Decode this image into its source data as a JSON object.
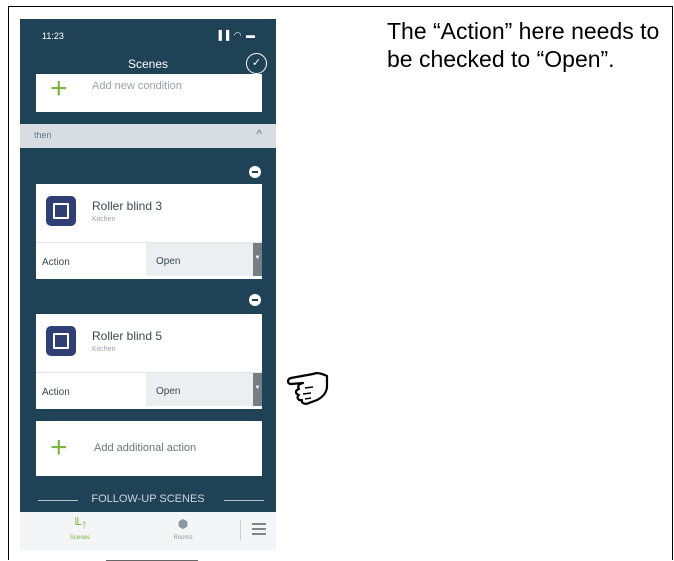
{
  "status": {
    "time": "11:23",
    "icons": "▐▐ ◠ ▬"
  },
  "nav": {
    "title": "Scenes",
    "confirm_glyph": "✓"
  },
  "condition": {
    "add_label": "Add new condition",
    "plus_glyph": "+"
  },
  "then_section": {
    "label": "then",
    "chevron": "^"
  },
  "actions": [
    {
      "device_name": "Roller blind 3",
      "room": "Kitchen",
      "action_label": "Action",
      "action_value": "Open"
    },
    {
      "device_name": "Roller blind 5",
      "room": "Kitchen",
      "action_label": "Action",
      "action_value": "Open"
    }
  ],
  "add_action": {
    "label": "Add additional action",
    "plus_glyph": "+"
  },
  "follow_up": {
    "label": "FOLLOW-UP SCENES"
  },
  "tabbar": {
    "scenes_label": "Scenes",
    "rooms_label": "Rooms",
    "scenes_glyph": "╙↑",
    "rooms_glyph": "⬢"
  },
  "annotation": {
    "text": "The “Action” here needs to be checked to “Open”."
  },
  "colors": {
    "app_background": "#1f4257",
    "accent_green": "#7cb342",
    "device_icon": "#2f3f74"
  }
}
